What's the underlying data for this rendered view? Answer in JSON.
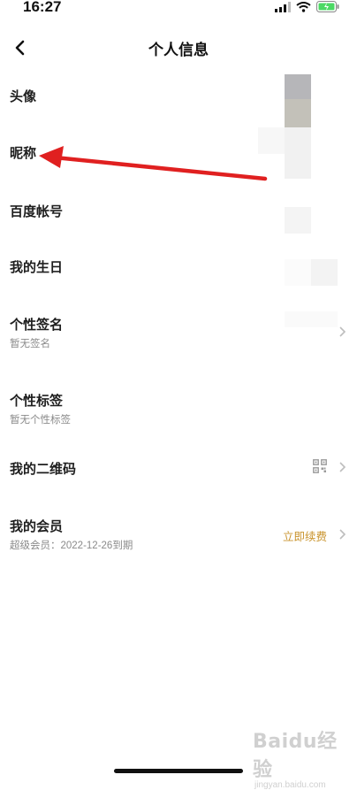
{
  "status_bar": {
    "time": "16:27"
  },
  "header": {
    "title": "个人信息"
  },
  "rows": [
    {
      "label": "头像"
    },
    {
      "label": "昵称"
    },
    {
      "label": "百度帐号"
    },
    {
      "label": "我的生日"
    },
    {
      "label": "个性签名",
      "sub": "暂无签名"
    },
    {
      "label": "个性标签",
      "sub": "暂无个性标签"
    },
    {
      "label": "我的二维码"
    },
    {
      "label": "我的会员",
      "sub": "超级会员：2022-12-26到期",
      "action": "立即续费"
    }
  ],
  "watermark": {
    "main": "Baidu经验",
    "sub": "jingyan.baidu.com"
  },
  "colors": {
    "action": "#c9932c",
    "annotation_arrow": "#e02020"
  },
  "icons": [
    "back-icon",
    "signal-icon",
    "wifi-icon",
    "battery-icon",
    "qr-code-icon",
    "chevron-right-icon"
  ]
}
